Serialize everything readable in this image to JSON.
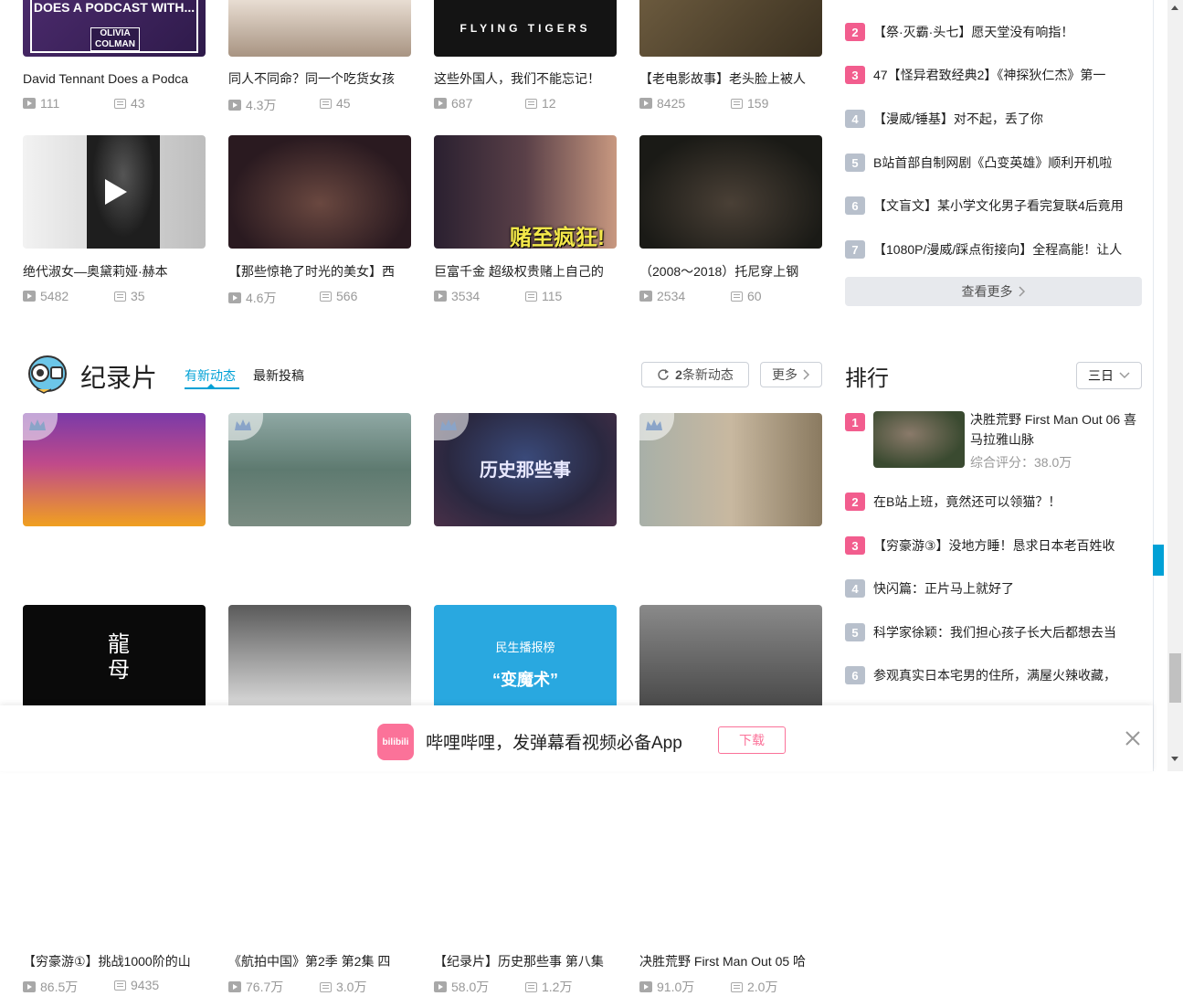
{
  "top_cards": [
    {
      "title": "David Tennant Does a Podca",
      "plays": "111",
      "danmaku": "43",
      "thumb_text": "DOES A PODCAST WITH...",
      "thumb_sub": "OLIVIA COLMAN"
    },
    {
      "title": "同人不同命？同一个吃货女孩",
      "plays": "4.3万",
      "danmaku": "45"
    },
    {
      "title": "这些外国人，我们不能忘记！",
      "plays": "687",
      "danmaku": "12",
      "thumb_text": "FLYING TIGERS"
    },
    {
      "title": "【老电影故事】老头脸上被人",
      "plays": "8425",
      "danmaku": "159"
    },
    {
      "title": "绝代淑女—奥黛莉娅·赫本",
      "plays": "5482",
      "danmaku": "35"
    },
    {
      "title": "【那些惊艳了时光的美女】西",
      "plays": "4.6万",
      "danmaku": "566"
    },
    {
      "title": "巨富千金 超级权贵赌上自己的",
      "plays": "3534",
      "danmaku": "115",
      "thumb_text": "赌至疯狂!"
    },
    {
      "title": "（2008～2018）托尼穿上钢",
      "plays": "2534",
      "danmaku": "60"
    }
  ],
  "top_rank": [
    {
      "num": "2",
      "text": "【祭·灭霸·头七】愿天堂没有响指！"
    },
    {
      "num": "3",
      "text": "47【怪异君致经典2】《神探狄仁杰》第一"
    },
    {
      "num": "4",
      "text": "【漫威/锤基】对不起，丢了你"
    },
    {
      "num": "5",
      "text": "B站首部自制网剧《凸变英雄》顺利开机啦"
    },
    {
      "num": "6",
      "text": "【文盲文】某小学文化男子看完复联4后竟用"
    },
    {
      "num": "7",
      "text": "【1080P/漫威/踩点衔接向】全程高能！让人"
    }
  ],
  "see_more_label": "查看更多",
  "section": {
    "title": "纪录片",
    "tab_active": "有新动态",
    "tab_other": "最新投稿",
    "new_count": "2",
    "new_label": "条新动态",
    "more_label": "更多",
    "rank_title": "排行",
    "rank_period": "三日"
  },
  "doc_cards": [
    {
      "title": "【穷豪游①】挑战1000阶的山",
      "plays": "86.5万",
      "danmaku": "9435"
    },
    {
      "title": "《航拍中国》第2季 第2集 四",
      "plays": "76.7万",
      "danmaku": "3.0万"
    },
    {
      "title": "【纪录片】历史那些事 第八集",
      "plays": "58.0万",
      "danmaku": "1.2万",
      "thumb_text": "历史那些事"
    },
    {
      "title": "决胜荒野 First Man Out 05 哈",
      "plays": "91.0万",
      "danmaku": "2.0万"
    }
  ],
  "bottom_cards": [
    {
      "thumb_text": "龍母"
    },
    {},
    {
      "thumb_text": "民生播报榜",
      "thumb_sub": "“变魔术”"
    },
    {}
  ],
  "doc_rank_featured": {
    "num": "1",
    "title": "决胜荒野 First Man Out 06 喜马拉雅山脉",
    "score": "综合评分：38.0万"
  },
  "doc_rank": [
    {
      "num": "2",
      "text": "在B站上班，竟然还可以领猫？！"
    },
    {
      "num": "3",
      "text": "【穷豪游③】没地方睡！恳求日本老百姓收"
    },
    {
      "num": "4",
      "text": "快闪篇：正片马上就好了"
    },
    {
      "num": "5",
      "text": "科学家徐颖：我们担心孩子长大后都想去当"
    },
    {
      "num": "6",
      "text": "参观真实日本宅男的住所，满屋火辣收藏，"
    }
  ],
  "banner": {
    "logo": "bilibili",
    "text": "哔哩哔哩，发弹幕看视频必备App",
    "download": "下载"
  },
  "colors": {
    "accent": "#00a1d6",
    "pink": "#fb7299",
    "hot_rank": "#f25d8e",
    "cold_rank": "#b8c0cc"
  }
}
